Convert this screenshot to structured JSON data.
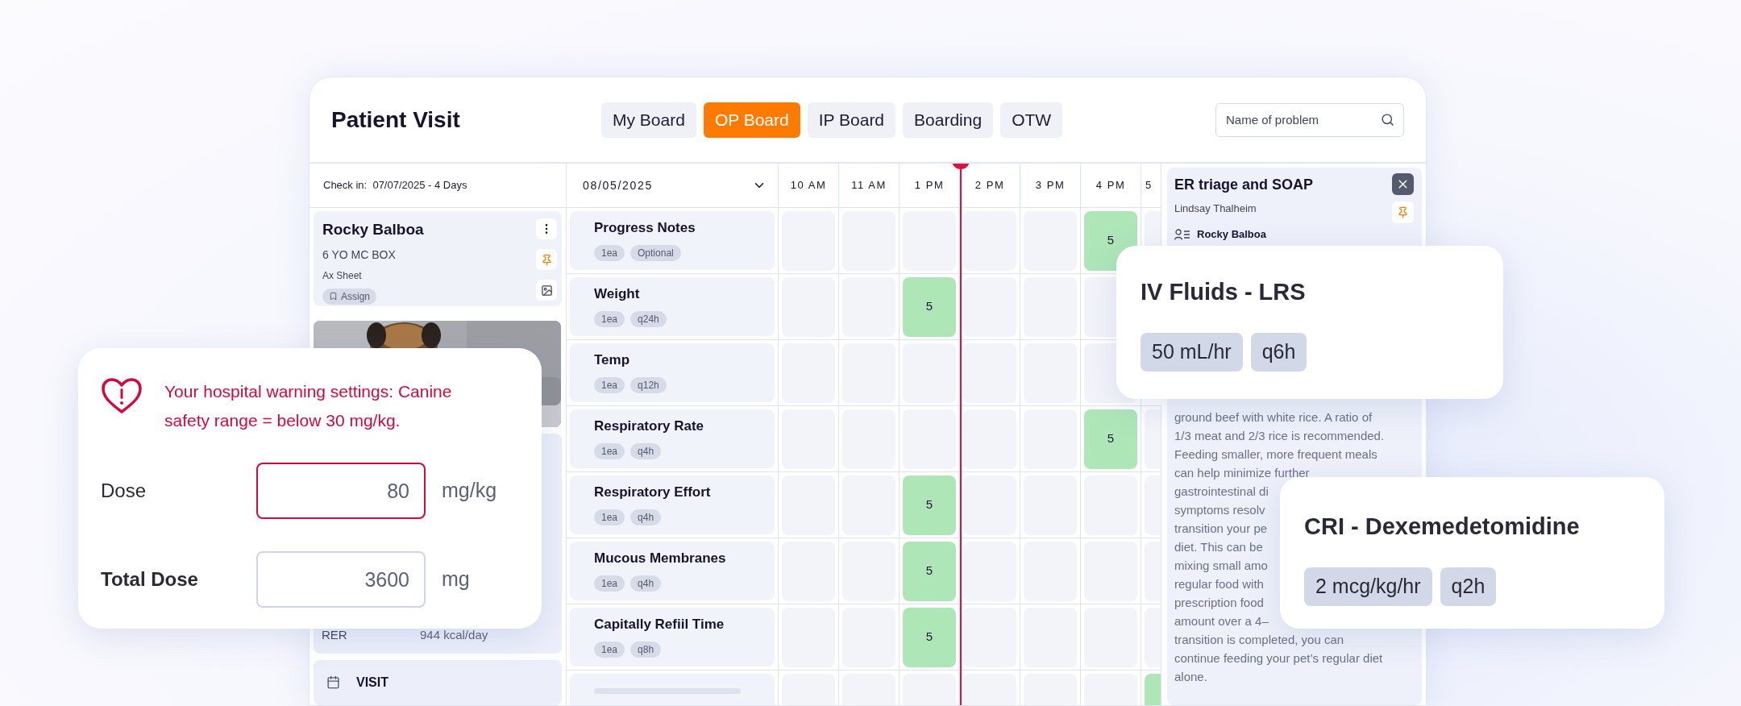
{
  "header": {
    "title": "Patient Visit"
  },
  "tabs": [
    {
      "label": "My Board",
      "selected": false
    },
    {
      "label": "OP Board",
      "selected": true
    },
    {
      "label": "IP Board",
      "selected": false
    },
    {
      "label": "Boarding",
      "selected": false
    },
    {
      "label": "OTW",
      "selected": false
    }
  ],
  "search": {
    "placeholder": "Name of problem"
  },
  "check_in": "Check in:  07/07/2025 - 4 Days",
  "date_picker": {
    "value": "08/05/2025"
  },
  "time_columns": [
    "10 AM",
    "11 AM",
    "1 PM",
    "2 PM",
    "3 PM",
    "4 PM",
    "5"
  ],
  "patient": {
    "name": "Rocky Balboa",
    "signalment": "6 YO MC BOX",
    "sheet": "Ax Sheet",
    "assign": "Assign"
  },
  "patient_details": [
    {
      "label": "RER",
      "value": "944 kcal/day"
    }
  ],
  "nav": [
    {
      "label": "VISIT"
    }
  ],
  "treatments": [
    {
      "kind": "treatment",
      "name": "Progress Notes",
      "tags": [
        "1ea",
        "Optional"
      ],
      "cells": [
        {
          "done": false
        },
        {
          "done": false
        },
        {
          "done": false
        },
        {
          "done": false
        },
        {
          "done": false
        },
        {
          "done": true,
          "count": "5"
        },
        {
          "done": false
        }
      ]
    },
    {
      "kind": "treatment",
      "name": "Weight",
      "tags": [
        "1ea",
        "q24h"
      ],
      "cells": [
        {
          "done": false
        },
        {
          "done": false
        },
        {
          "done": true,
          "count": "5"
        },
        {
          "done": false
        },
        {
          "done": false
        },
        {
          "done": false
        }
      ]
    },
    {
      "kind": "treatment",
      "name": "Temp",
      "tags": [
        "1ea",
        "q12h"
      ],
      "cells": [
        {
          "done": false
        },
        {
          "done": false
        },
        {
          "done": false
        },
        {
          "done": false
        },
        {
          "done": false
        },
        {
          "done": false
        }
      ]
    },
    {
      "kind": "treatment",
      "name": "Respiratory Rate",
      "tags": [
        "1ea",
        "q4h"
      ],
      "cells": [
        {
          "done": false
        },
        {
          "done": false
        },
        {
          "done": false
        },
        {
          "done": false
        },
        {
          "done": false
        },
        {
          "done": true,
          "count": "5"
        },
        {
          "done": false
        }
      ]
    },
    {
      "kind": "treatment",
      "name": "Respiratory Effort",
      "tags": [
        "1ea",
        "q4h"
      ],
      "cells": [
        {
          "done": false
        },
        {
          "done": false
        },
        {
          "done": true,
          "count": "5"
        },
        {
          "done": false
        },
        {
          "done": false
        },
        {
          "done": false
        },
        {
          "done": false
        }
      ]
    },
    {
      "kind": "treatment",
      "name": "Mucous Membranes",
      "tags": [
        "1ea",
        "q4h"
      ],
      "cells": [
        {
          "done": false
        },
        {
          "done": false
        },
        {
          "done": true,
          "count": "5"
        },
        {
          "done": false
        },
        {
          "done": false
        },
        {
          "done": false
        },
        {
          "done": false
        }
      ]
    },
    {
      "kind": "treatment",
      "name": "Capitally Refiil Time",
      "tags": [
        "1ea",
        "q8h"
      ],
      "cells": [
        {
          "done": false
        },
        {
          "done": false
        },
        {
          "done": true,
          "count": "5"
        },
        {
          "done": false
        },
        {
          "done": false
        },
        {
          "done": false
        },
        {
          "done": false
        }
      ]
    },
    {
      "kind": "placeholder",
      "cells": [
        {
          "done": false
        },
        {
          "done": false
        },
        {
          "done": false
        },
        {
          "done": false
        },
        {
          "done": false
        },
        {
          "done": false
        },
        {
          "done": true
        }
      ]
    }
  ],
  "side_panel": {
    "title": "ER triage and SOAP",
    "author": "Lindsay Thalheim",
    "patient": "Rocky Balboa",
    "note_lines": [
      "ground beef with white rice. A ratio of",
      "1/3 meat and 2/3 rice is recommended.",
      "Feeding smaller, more frequent meals",
      "can help minimize further",
      "gastrointestinal di",
      "symptoms resolv",
      "transition your pe",
      "diet. This can be",
      "mixing small amo",
      "regular food with",
      "prescription food",
      "amount over a 4–",
      "transition is completed, you can",
      "continue feeding your pet’s regular diet",
      "alone."
    ]
  },
  "dose_card": {
    "warning": "Your hospital warning settings: Canine safety range = below 30 mg/kg.",
    "fields": [
      {
        "label": "Dose",
        "value": "80",
        "unit": "mg/kg",
        "invalid": true,
        "emphasis": false
      },
      {
        "label": "Total Dose",
        "value": "3600",
        "unit": "mg",
        "invalid": false,
        "emphasis": true
      }
    ]
  },
  "order_cards": [
    {
      "title": "IV Fluids - LRS",
      "tags": [
        "50 mL/hr",
        "q6h"
      ]
    },
    {
      "title": "CRI - Dexemedetomidine",
      "tags": [
        "2 mcg/kg/hr",
        "q2h"
      ]
    }
  ]
}
